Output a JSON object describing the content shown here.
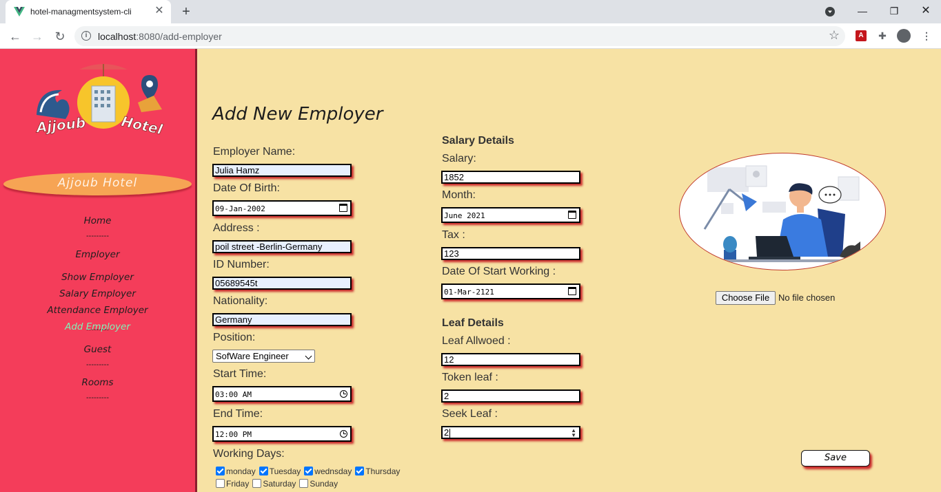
{
  "browser": {
    "tab_title": "hotel-managmentsystem-cli",
    "url_host": "localhost",
    "url_path": ":8080/add-employer"
  },
  "sidebar": {
    "brand": "Ajjoub Hotel",
    "logo_text": "Ajjoub Hotel",
    "separator": "---------",
    "nav": {
      "home": "Home",
      "employer": "Employer",
      "show_employer": "Show Employer",
      "salary_employer": "Salary Employer",
      "attendance_employer": "Attendance Employer",
      "add_employer": "Add Employer",
      "guest": "Guest",
      "rooms": "Rooms"
    },
    "active_color": "#7ff5b9",
    "bg_color": "#f43d5a"
  },
  "form": {
    "title": "Add New Employer",
    "employer_name_label": "Employer Name:",
    "employer_name": "Julia Hamz",
    "dob_label": "Date Of Birth:",
    "dob": "09-Jan-2002",
    "address_label": "Address :",
    "address": "poil street -Berlin-Germany",
    "id_label": "ID Number:",
    "id_number": "05689545t",
    "nationality_label": "Nationality:",
    "nationality": "Germany",
    "position_label": "Position:",
    "position": "SofWare Engineer",
    "start_time_label": "Start Time:",
    "start_time": "03:00 AM",
    "end_time_label": "End Time:",
    "end_time": "12:00 PM",
    "working_days_label": "Working Days:",
    "days": {
      "monday": {
        "label": "monday",
        "checked": true
      },
      "tuesday": {
        "label": "Tuesday",
        "checked": true
      },
      "wednesday": {
        "label": "wednsday",
        "checked": true
      },
      "thursday": {
        "label": "Thursday",
        "checked": true
      },
      "friday": {
        "label": "Friday",
        "checked": false
      },
      "saturday": {
        "label": "Saturday",
        "checked": false
      },
      "sunday": {
        "label": "Sunday",
        "checked": false
      }
    },
    "salary_section": "Salary Details",
    "salary_label": "Salary:",
    "salary": "1852",
    "month_label": "Month:",
    "month": "June 2021",
    "tax_label": "Tax :",
    "tax": "123",
    "start_working_label": "Date Of Start Working :",
    "start_working": "01-Mar-2121",
    "leaf_section": "Leaf Details",
    "leaf_allowed_label": "Leaf Allwoed :",
    "leaf_allowed": "12",
    "token_leaf_label": "Token leaf :",
    "token_leaf": "2",
    "seek_leaf_label": "Seek Leaf :",
    "seek_leaf": "2",
    "file_button": "Choose File",
    "file_status": "No file chosen",
    "save_button": "Save"
  }
}
